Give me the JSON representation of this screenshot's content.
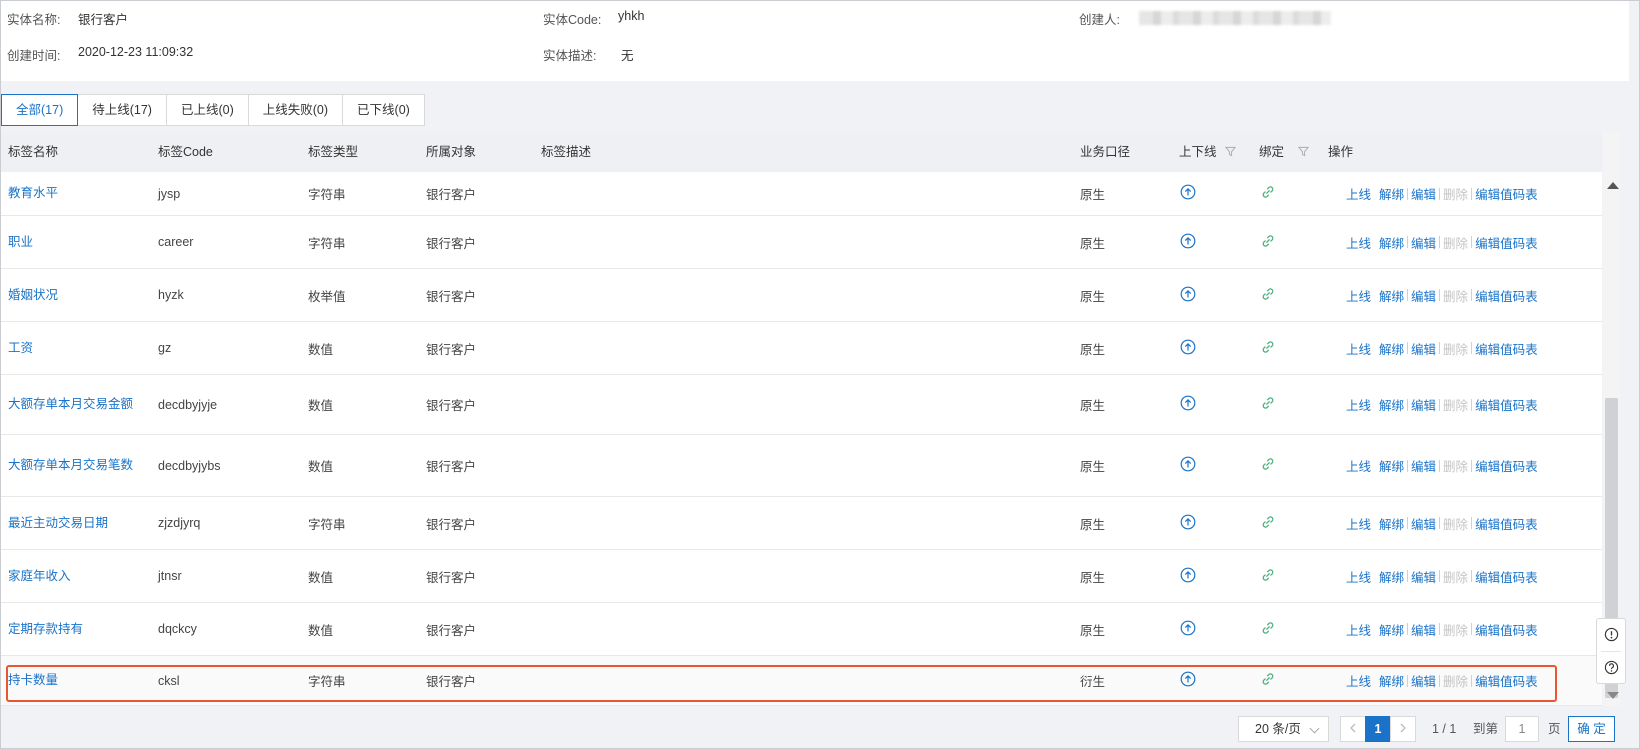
{
  "info": {
    "entity_name_label": "实体名称:",
    "entity_name": "银行客户",
    "entity_code_label": "实体Code:",
    "entity_code": "yhkh",
    "creator_label": "创建人:",
    "created_time_label": "创建时间:",
    "created_time": "2020-12-23 11:09:32",
    "entity_desc_label": "实体描述:",
    "entity_desc": "无"
  },
  "tabs": [
    {
      "label": "全部(17)"
    },
    {
      "label": "待上线(17)"
    },
    {
      "label": "已上线(0)"
    },
    {
      "label": "上线失败(0)"
    },
    {
      "label": "已下线(0)"
    }
  ],
  "table": {
    "columns": [
      "标签名称",
      "标签Code",
      "标签类型",
      "所属对象",
      "标签描述",
      "业务口径",
      "上下线",
      "绑定",
      "操作"
    ],
    "ops": {
      "online": "上线",
      "unbind": "解绑",
      "edit": "编辑",
      "delete": "删除",
      "edit_codes": "编辑值码表"
    },
    "rows": [
      {
        "name": "教育水平",
        "code": "jysp",
        "type": "字符串",
        "object": "银行客户",
        "desc": "",
        "caliber": "原生"
      },
      {
        "name": "职业",
        "code": "career",
        "type": "字符串",
        "object": "银行客户",
        "desc": "",
        "caliber": "原生"
      },
      {
        "name": "婚姻状况",
        "code": "hyzk",
        "type": "枚举值",
        "object": "银行客户",
        "desc": "",
        "caliber": "原生"
      },
      {
        "name": "工资",
        "code": "gz",
        "type": "数值",
        "object": "银行客户",
        "desc": "",
        "caliber": "原生"
      },
      {
        "name": "大额存单本月交易金额",
        "code": "decdbyjyje",
        "type": "数值",
        "object": "银行客户",
        "desc": "",
        "caliber": "原生"
      },
      {
        "name": "大额存单本月交易笔数",
        "code": "decdbyjybs",
        "type": "数值",
        "object": "银行客户",
        "desc": "",
        "caliber": "原生"
      },
      {
        "name": "最近主动交易日期",
        "code": "zjzdjyrq",
        "type": "字符串",
        "object": "银行客户",
        "desc": "",
        "caliber": "原生"
      },
      {
        "name": "家庭年收入",
        "code": "jtnsr",
        "type": "数值",
        "object": "银行客户",
        "desc": "",
        "caliber": "原生"
      },
      {
        "name": "定期存款持有",
        "code": "dqckcy",
        "type": "数值",
        "object": "银行客户",
        "desc": "",
        "caliber": "原生"
      },
      {
        "name": "持卡数量",
        "code": "cksl",
        "type": "字符串",
        "object": "银行客户",
        "desc": "",
        "caliber": "衍生"
      }
    ]
  },
  "pagination": {
    "page_size": "20 条/页",
    "current_page": "1",
    "page_info": "1 / 1",
    "goto_label": "到第",
    "page_input": "1",
    "page_suffix": "页",
    "confirm": "确 定"
  },
  "colors": {
    "accent": "#1a73c9",
    "link_icon": "#4caf7d",
    "highlight": "#e8572f"
  }
}
